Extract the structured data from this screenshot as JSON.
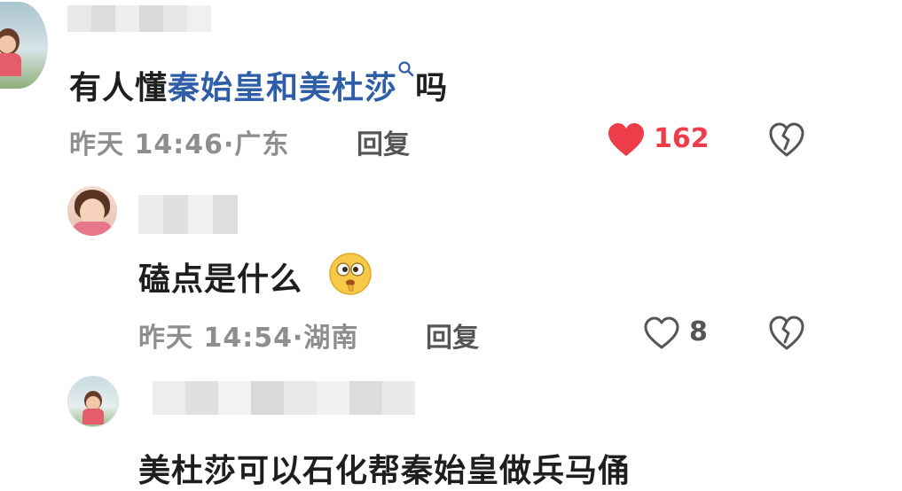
{
  "comments": [
    {
      "content_prefix": "有人懂",
      "content_links": [
        "秦始皇",
        "和",
        "美杜莎"
      ],
      "content_suffix": "吗",
      "time": "昨天 14:46",
      "location": "广东",
      "reply_label": "回复",
      "likes": "162",
      "liked": true
    },
    {
      "content": "磕点是什么",
      "time": "昨天 14:54",
      "location": "湖南",
      "reply_label": "回复",
      "likes": "8",
      "liked": false
    },
    {
      "content": "美杜莎可以石化帮秦始皇做兵马俑"
    }
  ],
  "colors": {
    "link": "#2f5ea8",
    "like_active": "#ee3d4a",
    "meta": "#8e8e8e",
    "icon": "#555555"
  },
  "icons": [
    "search-icon",
    "heart-filled-icon",
    "heart-outline-icon",
    "broken-heart-icon",
    "thinking-emoji-icon"
  ]
}
